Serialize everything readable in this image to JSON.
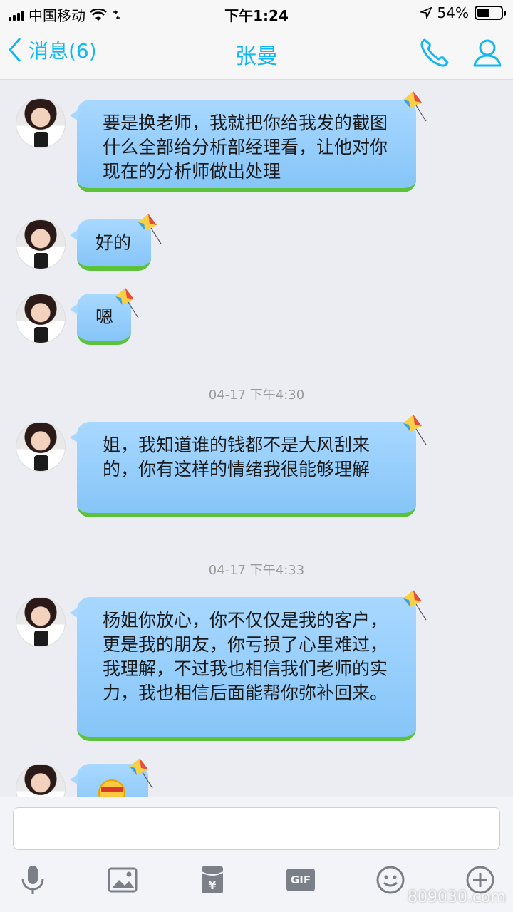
{
  "status_bar": {
    "carrier": "中国移动",
    "time": "下午1:24",
    "battery_percent": "54%",
    "battery_level": 0.54
  },
  "nav": {
    "back_label": "消息(6)",
    "title": "张曼"
  },
  "messages": [
    {
      "text": "要是换老师，我就把你给我发的截图什么全部给分析部经理看，让他对你现在的分析师做出处理"
    },
    {
      "text": "好的"
    },
    {
      "text": "嗯"
    },
    {
      "timestamp": "04-17 下午4:30"
    },
    {
      "text": "姐，我知道谁的钱都不是大风刮来的，你有这样的情绪我很能够理解"
    },
    {
      "timestamp": "04-17 下午4:33"
    },
    {
      "text": "杨姐你放心，你不仅仅是我的客户，更是我的朋友，你亏损了心里难过，我理解，不过我也相信我们老师的实力，我也相信后面能帮你弥补回来。"
    }
  ],
  "toolbar": {
    "gif_label": "GIF"
  },
  "watermark": "809030.com",
  "colors": {
    "accent": "#12b7f5",
    "bubble": "#a8d8ff",
    "grass": "#5cc23a"
  }
}
